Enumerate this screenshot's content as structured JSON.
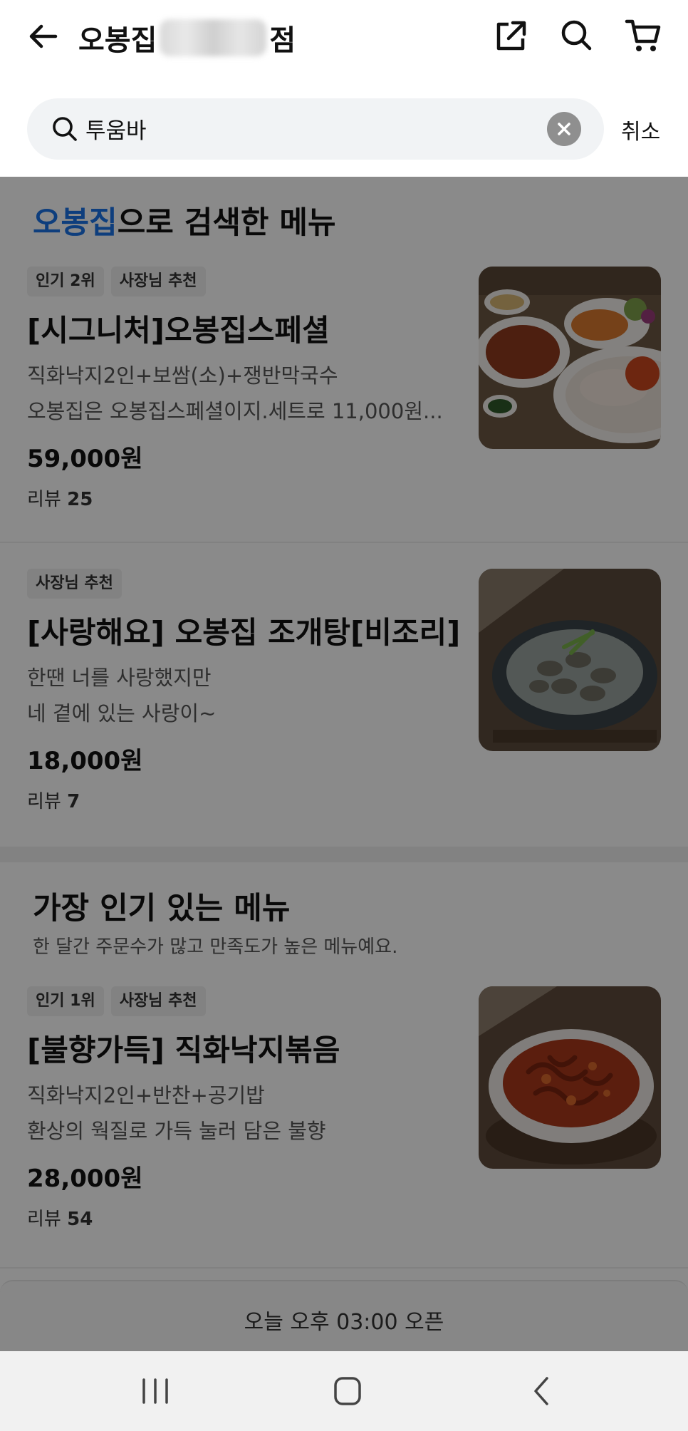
{
  "app_bar": {
    "store_name_prefix": "오봉집",
    "store_name_suffix": "점",
    "icons": [
      "back-arrow-icon",
      "share-icon",
      "search-icon",
      "cart-icon"
    ]
  },
  "search": {
    "query": "투움바",
    "cancel_label": "취소"
  },
  "search_results": {
    "title_highlight": "오봉집",
    "title_rest": "으로 검색한 메뉴",
    "highlight_color": "#1a73e8",
    "items": [
      {
        "badges": [
          "인기 2위",
          "사장님 추천"
        ],
        "name": "[시그니처]오봉집스페셜",
        "desc1": "직화낙지2인+보쌈(소)+쟁반막국수",
        "desc2": "오봉집은 오봉집스페셜이지.세트로 11,000원...",
        "price": "59,000원",
        "review_label": "리뷰",
        "review_count": "25",
        "image": "food-platter-image"
      },
      {
        "badges": [
          "사장님 추천"
        ],
        "name": "[사랑해요] 오봉집 조개탕[비조리]",
        "desc1": "한땐 너를 사랑했지만",
        "desc2": "네 곁에 있는 사랑이~",
        "price": "18,000원",
        "review_label": "리뷰",
        "review_count": "7",
        "image": "clam-soup-image"
      }
    ]
  },
  "popular": {
    "title": "가장 인기 있는 메뉴",
    "subtitle": "한 달간 주문수가 많고 만족도가 높은 메뉴예요.",
    "items": [
      {
        "badges": [
          "인기 1위",
          "사장님 추천"
        ],
        "name": "[불향가득] 직화낙지볶음",
        "desc1": "직화낙지2인+반찬+공기밥",
        "desc2": "환상의 웍질로 가득 눌러 담은 불향",
        "price": "28,000원",
        "review_label": "리뷰",
        "review_count": "54",
        "image": "stir-fried-octopus-image"
      }
    ]
  },
  "open_notice": "오늘 오후 03:00 오픈",
  "system_nav": [
    "recents-icon",
    "home-icon",
    "back-icon"
  ]
}
